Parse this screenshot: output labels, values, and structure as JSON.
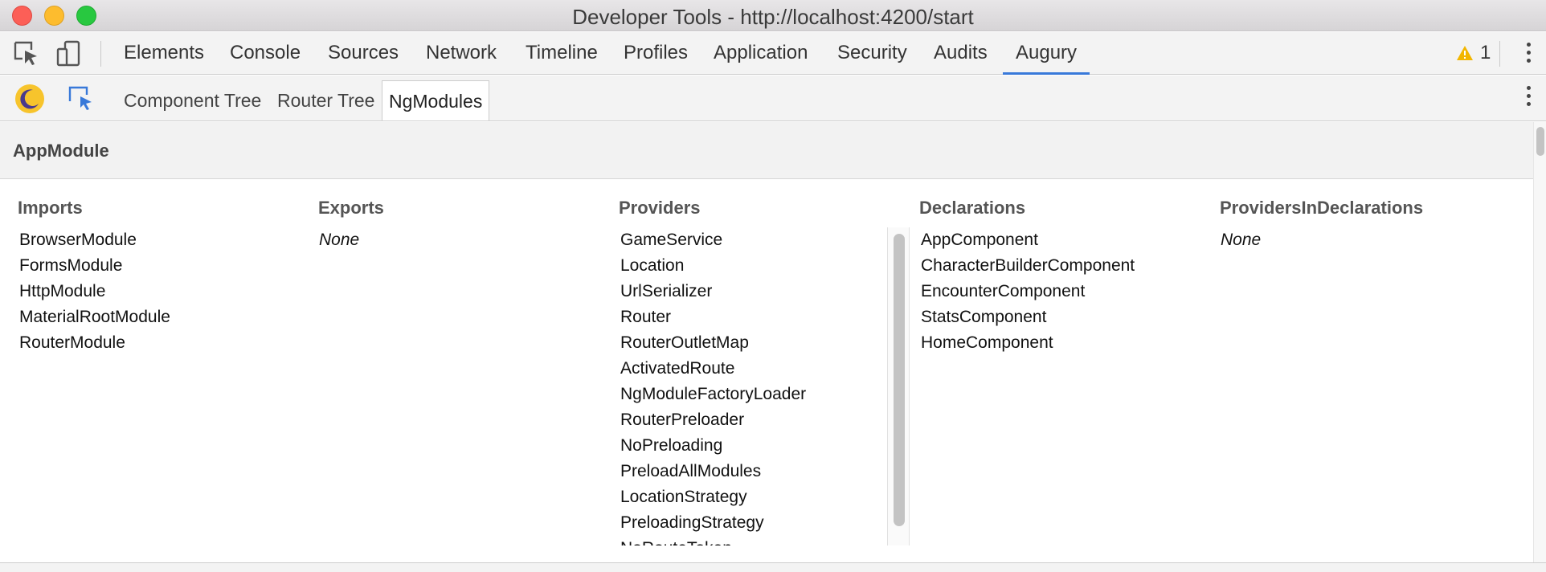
{
  "window": {
    "title": "Developer Tools - http://localhost:4200/start"
  },
  "devtools_tabs": [
    {
      "label": "Elements"
    },
    {
      "label": "Console"
    },
    {
      "label": "Sources"
    },
    {
      "label": "Network"
    },
    {
      "label": "Timeline"
    },
    {
      "label": "Profiles"
    },
    {
      "label": "Application"
    },
    {
      "label": "Security"
    },
    {
      "label": "Audits"
    },
    {
      "label": "Augury",
      "active": true
    }
  ],
  "warnings": {
    "count": "1",
    "icon": "warning-triangle-icon",
    "color": "#f2b600"
  },
  "augury": {
    "logo_icon": "augury-moon-logo-icon",
    "subtabs": [
      {
        "label": "Component Tree"
      },
      {
        "label": "Router Tree"
      },
      {
        "label": "NgModules",
        "active": true
      }
    ]
  },
  "module": {
    "name": "AppModule",
    "columns": {
      "imports": {
        "header": "Imports",
        "items": [
          "BrowserModule",
          "FormsModule",
          "HttpModule",
          "MaterialRootModule",
          "RouterModule"
        ]
      },
      "exports": {
        "header": "Exports",
        "empty_text": "None"
      },
      "providers": {
        "header": "Providers",
        "items": [
          "GameService",
          "Location",
          "UrlSerializer",
          "Router",
          "RouterOutletMap",
          "ActivatedRoute",
          "NgModuleFactoryLoader",
          "RouterPreloader",
          "NoPreloading",
          "PreloadAllModules",
          "LocationStrategy",
          "PreloadingStrategy",
          "NoRouteToken"
        ]
      },
      "declarations": {
        "header": "Declarations",
        "items": [
          "AppComponent",
          "CharacterBuilderComponent",
          "EncounterComponent",
          "StatsComponent",
          "HomeComponent"
        ]
      },
      "providers_in_declarations": {
        "header": "ProvidersInDeclarations",
        "empty_text": "None"
      }
    }
  },
  "colors": {
    "active_tab_underline": "#3879d9",
    "augury_logo": "#f7c42c",
    "inspect_icon_blue": "#3879d9"
  }
}
